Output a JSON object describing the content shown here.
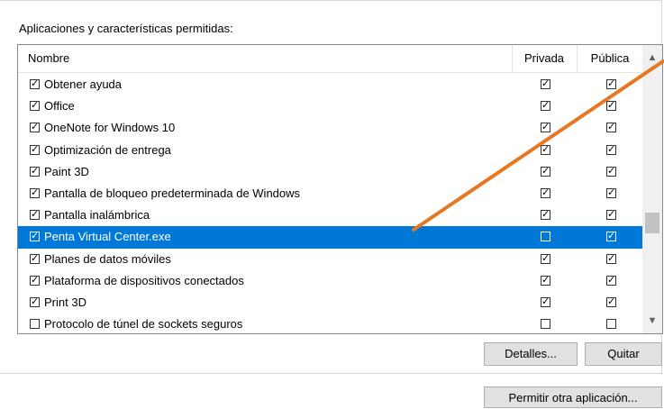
{
  "section_title": "Aplicaciones y características permitidas:",
  "table": {
    "columns": [
      "Nombre",
      "Privada",
      "Pública"
    ],
    "rows": [
      {
        "label": "Obtener ayuda",
        "enabled": true,
        "private": true,
        "public": true,
        "selected": false
      },
      {
        "label": "Office",
        "enabled": true,
        "private": true,
        "public": true,
        "selected": false
      },
      {
        "label": "OneNote for Windows 10",
        "enabled": true,
        "private": true,
        "public": true,
        "selected": false
      },
      {
        "label": "Optimización de entrega",
        "enabled": true,
        "private": true,
        "public": true,
        "selected": false
      },
      {
        "label": "Paint 3D",
        "enabled": true,
        "private": true,
        "public": true,
        "selected": false
      },
      {
        "label": "Pantalla de bloqueo predeterminada de Windows",
        "enabled": true,
        "private": true,
        "public": true,
        "selected": false
      },
      {
        "label": "Pantalla inalámbrica",
        "enabled": true,
        "private": true,
        "public": true,
        "selected": false
      },
      {
        "label": "Penta Virtual Center.exe",
        "enabled": true,
        "private": false,
        "public": true,
        "selected": true
      },
      {
        "label": "Planes de datos móviles",
        "enabled": true,
        "private": true,
        "public": true,
        "selected": false
      },
      {
        "label": "Plataforma de dispositivos conectados",
        "enabled": true,
        "private": true,
        "public": true,
        "selected": false
      },
      {
        "label": "Print 3D",
        "enabled": true,
        "private": true,
        "public": true,
        "selected": false
      },
      {
        "label": "Protocolo de túnel de sockets seguros",
        "enabled": false,
        "private": false,
        "public": false,
        "selected": false
      }
    ]
  },
  "buttons": {
    "details": "Detalles...",
    "remove": "Quitar",
    "allow_other": "Permitir otra aplicación..."
  },
  "colors": {
    "selection": "#0078d7",
    "annotation_line": "#e87722"
  },
  "icons": {
    "scroll_up": "chevron-up-icon",
    "scroll_down": "chevron-down-icon",
    "check": "checkmark-icon"
  }
}
